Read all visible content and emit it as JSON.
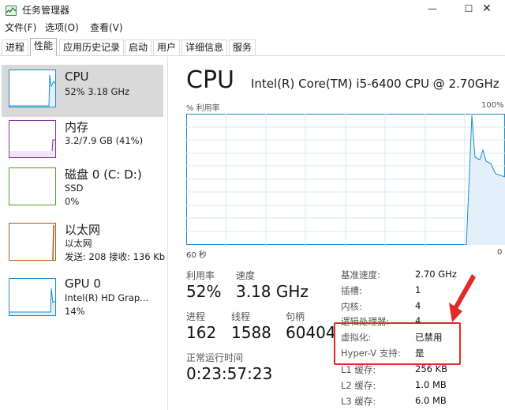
{
  "window": {
    "title": "任务管理器",
    "controls": {
      "minimize": "—",
      "maximize": "☐",
      "close": "✕"
    }
  },
  "menu": [
    "文件(F)",
    "选项(O)",
    "查看(V)"
  ],
  "tabs": [
    "进程",
    "性能",
    "应用历史记录",
    "启动",
    "用户",
    "详细信息",
    "服务"
  ],
  "active_tab": "性能",
  "sidebar": {
    "items": [
      {
        "title": "CPU",
        "sub1": "52%  3.18 GHz",
        "color": "#1a8fc9"
      },
      {
        "title": "内存",
        "sub1": "3.2/7.9 GB (41%)",
        "color": "#8b2fa6"
      },
      {
        "title": "磁盘 0 (C: D:)",
        "sub1": "SSD",
        "sub2": "0%",
        "color": "#4ca41c"
      },
      {
        "title": "以太网",
        "sub1": "以太网",
        "sub2": "发送: 208  接收: 136 Kb",
        "color": "#b4561a"
      },
      {
        "title": "GPU 0",
        "sub1": "Intel(R) HD Grap...",
        "sub2": "14%",
        "color": "#1a8fc9"
      }
    ]
  },
  "main": {
    "title": "CPU",
    "model": "Intel(R) Core(TM) i5-6400 CPU @ 2.70GHz",
    "graph": {
      "ylabel": "% 利用率",
      "ymax_label": "100%",
      "xleft_label": "60 秒",
      "xright_label": "0",
      "line_color": "#1a8fc9",
      "fill_color": "#e3f0f9",
      "grid_color": "#d9e8f2"
    },
    "stats": {
      "utilization": {
        "label": "利用率",
        "value": "52%"
      },
      "speed": {
        "label": "速度",
        "value": "3.18 GHz"
      },
      "processes": {
        "label": "进程",
        "value": "162"
      },
      "threads": {
        "label": "线程",
        "value": "1588"
      },
      "handles": {
        "label": "句柄",
        "value": "60404"
      },
      "uptime": {
        "label": "正常运行时间",
        "value": "0:23:57:23"
      }
    },
    "specs": [
      {
        "label": "基准速度:",
        "value": "2.70 GHz"
      },
      {
        "label": "插槽:",
        "value": "1"
      },
      {
        "label": "内核:",
        "value": "4"
      },
      {
        "label": "逻辑处理器:",
        "value": "4"
      },
      {
        "label": "虚拟化:",
        "value": "已禁用"
      },
      {
        "label": "Hyper-V 支持:",
        "value": "是"
      },
      {
        "label": "L1 缓存:",
        "value": "256 KB"
      },
      {
        "label": "L2 缓存:",
        "value": "1.0 MB"
      },
      {
        "label": "L3 缓存:",
        "value": "6.0 MB"
      }
    ],
    "annotation_color": "#e02a2a"
  }
}
